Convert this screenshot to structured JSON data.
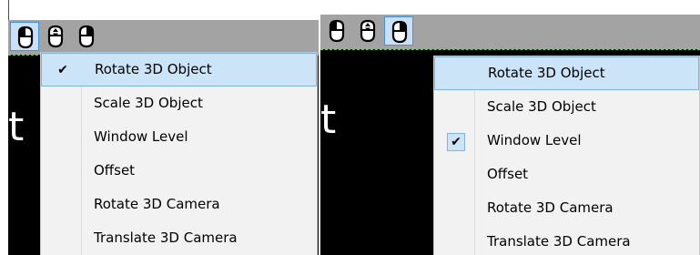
{
  "colors": {
    "toolbar": "#a3a3a3",
    "active_button_bg": "#c9e0f7",
    "active_button_border": "#4a90d9",
    "viewport": "#000000",
    "menu_bg": "#f2f2f2",
    "menu_hover": "#cce4f7",
    "dashed_line": "#5fd35f"
  },
  "toolbar": {
    "buttons": [
      {
        "icon": "mouse-left-button-icon"
      },
      {
        "icon": "mouse-scroll-wheel-icon"
      },
      {
        "icon": "mouse-right-button-icon"
      }
    ]
  },
  "viewport_text": "t",
  "left_panel": {
    "active_button": "mouse-left-button",
    "menu": {
      "checked_item": "Rotate 3D Object",
      "hovered_item": "Rotate 3D Object",
      "items": [
        {
          "label": "Rotate 3D Object"
        },
        {
          "label": "Scale 3D Object"
        },
        {
          "label": "Window Level"
        },
        {
          "label": "Offset"
        },
        {
          "label": "Rotate 3D Camera"
        },
        {
          "label": "Translate 3D Camera"
        }
      ]
    }
  },
  "right_panel": {
    "active_button": "mouse-right-button",
    "menu": {
      "checked_item": "Window Level",
      "hovered_item": "Rotate 3D Object",
      "items": [
        {
          "label": "Rotate 3D Object"
        },
        {
          "label": "Scale 3D Object"
        },
        {
          "label": "Window Level"
        },
        {
          "label": "Offset"
        },
        {
          "label": "Rotate 3D Camera"
        },
        {
          "label": "Translate 3D Camera"
        }
      ]
    }
  }
}
